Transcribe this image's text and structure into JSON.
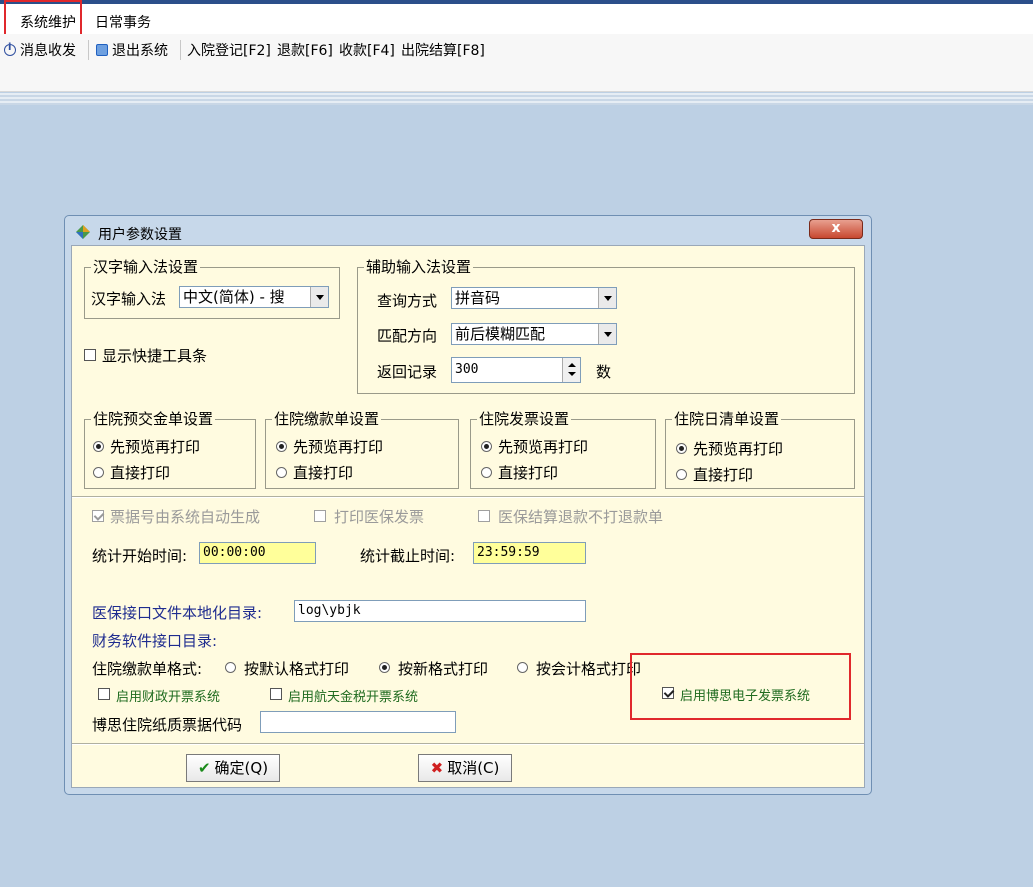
{
  "menubar": {
    "items": [
      "系统维护",
      "日常事务"
    ]
  },
  "toolbar": {
    "items": [
      {
        "label": "消息收发",
        "icon": "info-icon"
      },
      {
        "label": "退出系统",
        "icon": "exit-icon"
      },
      {
        "label": "入院登记[F2]"
      },
      {
        "label": "退款[F6]"
      },
      {
        "label": "收款[F4]"
      },
      {
        "label": "出院结算[F8]"
      }
    ]
  },
  "dialog": {
    "title": "用户参数设置",
    "close_label": "x",
    "hanzi_group": {
      "title": "汉字输入法设置",
      "label": "汉字输入法",
      "value": "中文(简体) - 搜"
    },
    "show_toolbar": {
      "label": "显示快捷工具条",
      "checked": false
    },
    "aux_group": {
      "title": "辅助输入法设置",
      "query_label": "查询方式",
      "query_value": "拼音码",
      "match_label": "匹配方向",
      "match_value": "前后模糊匹配",
      "return_label": "返回记录",
      "return_value": "300",
      "return_unit": "数"
    },
    "print_groups": [
      {
        "title": "住院预交金单设置",
        "opt1": "先预览再打印",
        "opt2": "直接打印",
        "selected": 0
      },
      {
        "title": "住院缴款单设置",
        "opt1": "先预览再打印",
        "opt2": "直接打印",
        "selected": 0
      },
      {
        "title": "住院发票设置",
        "opt1": "先预览再打印",
        "opt2": "直接打印",
        "selected": 0
      },
      {
        "title": "住院日清单设置",
        "opt1": "先预览再打印",
        "opt2": "直接打印",
        "selected": 0
      }
    ],
    "disabled_checks": [
      {
        "label": "票据号由系统自动生成",
        "checked": true
      },
      {
        "label": "打印医保发票",
        "checked": false
      },
      {
        "label": "医保结算退款不打退款单",
        "checked": false
      }
    ],
    "stat_start_label": "统计开始时间:",
    "stat_start_value": "00:00:00",
    "stat_end_label": "统计截止时间:",
    "stat_end_value": "23:59:59",
    "yb_dir_label": "医保接口文件本地化目录:",
    "yb_dir_value": "log\\ybjk",
    "finance_dir_label": "财务软件接口目录:",
    "payment_format_label": "住院缴款单格式:",
    "payment_formats": [
      "按默认格式打印",
      "按新格式打印",
      "按会计格式打印"
    ],
    "payment_selected": 1,
    "enable_finance": {
      "label": "启用财政开票系统",
      "checked": false
    },
    "enable_aerospace": {
      "label": "启用航天金税开票系统",
      "checked": false
    },
    "enable_bosi": {
      "label": "启用博思电子发票系统",
      "checked": true
    },
    "bosi_code_label": "博思住院纸质票据代码",
    "bosi_code_value": "",
    "ok_label": "确定(Q)",
    "cancel_label": "取消(C)"
  },
  "colors": {
    "highlight": "#e0282c",
    "dialog_bg": "#fffbe0",
    "time_field": "#ffff9a"
  }
}
